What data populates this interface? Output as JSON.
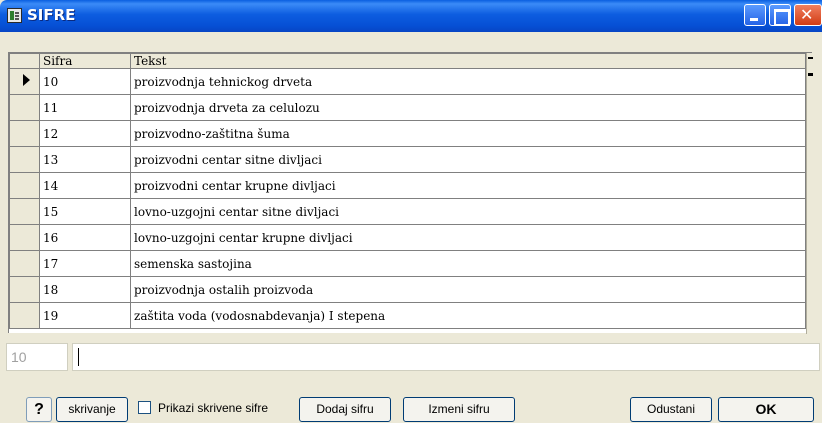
{
  "window": {
    "title": "SIFRE"
  },
  "grid": {
    "columns": [
      "Sifra",
      "Tekst"
    ],
    "rows": [
      {
        "sifra": "10",
        "tekst": "proizvodnja tehnickog drveta"
      },
      {
        "sifra": "11",
        "tekst": "proizvodnja drveta za celulozu"
      },
      {
        "sifra": "12",
        "tekst": "proizvodno-zaštitna šuma"
      },
      {
        "sifra": "13",
        "tekst": "proizvodni centar sitne divljaci"
      },
      {
        "sifra": "14",
        "tekst": "proizvodni centar krupne divljaci"
      },
      {
        "sifra": "15",
        "tekst": "lovno-uzgojni centar sitne divljaci"
      },
      {
        "sifra": "16",
        "tekst": "lovno-uzgojni centar krupne divljaci"
      },
      {
        "sifra": "17",
        "tekst": "semenska sastojina"
      },
      {
        "sifra": "18",
        "tekst": "proizvodnja ostalih proizvoda"
      },
      {
        "sifra": "19",
        "tekst": "zaštita voda (vodosnabdevanja) I stepena"
      }
    ]
  },
  "editor": {
    "code_value": "10",
    "text_value": ""
  },
  "buttons": {
    "help": "?",
    "hide": "skrivanje",
    "show_hidden_label": "Prikazi skrivene sifre",
    "add": "Dodaj sifru",
    "edit": "Izmeni sifru",
    "cancel": "Odustani",
    "ok": "OK"
  }
}
